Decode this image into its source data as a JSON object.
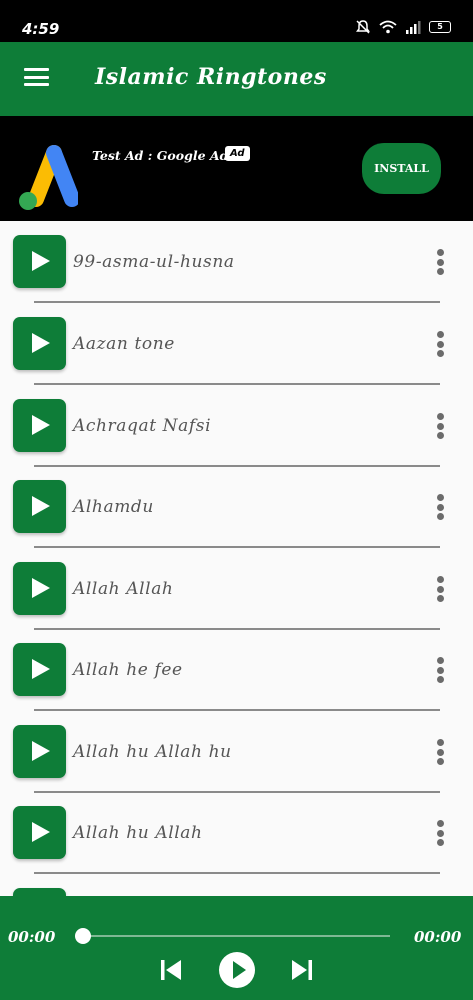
{
  "status_bar": {
    "time": "4:59",
    "battery": "5"
  },
  "app_bar": {
    "title": "Islamic Ringtones"
  },
  "ad": {
    "text": "Test Ad : Google Ads",
    "badge": "Ad",
    "install_label": "INSTALL"
  },
  "ringtones": [
    {
      "title": "99-asma-ul-husna"
    },
    {
      "title": "Aazan tone"
    },
    {
      "title": "Achraqat Nafsi"
    },
    {
      "title": "Alhamdu"
    },
    {
      "title": "Allah Allah"
    },
    {
      "title": "Allah he fee"
    },
    {
      "title": "Allah hu Allah hu"
    },
    {
      "title": "Allah hu Allah"
    },
    {
      "title": ""
    }
  ],
  "player": {
    "current_time": "00:00",
    "total_time": "00:00",
    "progress": 0
  },
  "colors": {
    "primary": "#0e7d38",
    "background": "#fafafa",
    "text": "#555555"
  }
}
